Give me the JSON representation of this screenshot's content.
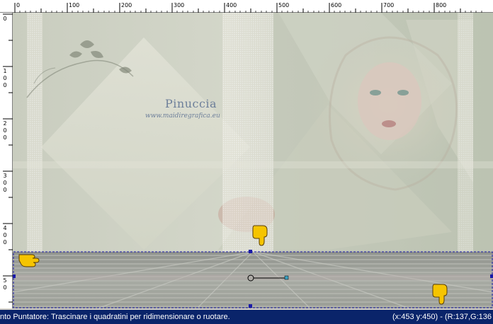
{
  "ruler": {
    "top_labels": [
      "0",
      "100",
      "200",
      "300",
      "400",
      "500",
      "600",
      "700",
      "800"
    ],
    "left_labels": [
      [
        "0"
      ],
      [
        "1",
        "0",
        "0"
      ],
      [
        "2",
        "0",
        "0"
      ],
      [
        "3",
        "0",
        "0"
      ],
      [
        "4",
        "0",
        "0"
      ],
      [
        "5",
        "0"
      ]
    ]
  },
  "watermark": {
    "title": "Pinuccia",
    "url": "www.maidiregrafica.eu"
  },
  "status": {
    "left": "nto Puntatore: Trascinare i quadratini per ridimensionare o ruotare.",
    "right": "(x:453 y:450) - (R:137,G:136"
  },
  "colors": {
    "selection": "#1a1aa8",
    "status_bg": "#0a246a",
    "hand": "#f5c400"
  }
}
